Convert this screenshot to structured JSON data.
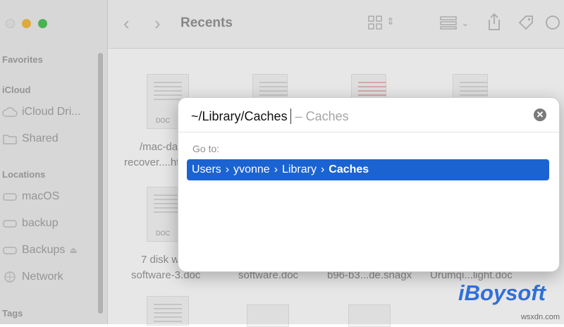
{
  "window": {
    "title": "Recents"
  },
  "sidebar": {
    "sections": [
      {
        "heading": "Favorites"
      },
      {
        "heading": "iCloud",
        "items": [
          {
            "label": "iCloud Dri...",
            "icon": "cloud-icon"
          },
          {
            "label": "Shared",
            "icon": "shared-folder-icon"
          }
        ]
      },
      {
        "heading": "Locations",
        "items": [
          {
            "label": "macOS",
            "icon": "drive-icon"
          },
          {
            "label": "backup",
            "icon": "drive-icon"
          },
          {
            "label": "Backups",
            "icon": "drive-icon",
            "badge": "eject-icon"
          },
          {
            "label": "Network",
            "icon": "network-icon"
          }
        ]
      },
      {
        "heading": "Tags"
      }
    ]
  },
  "files": {
    "row1": [
      {
        "name_line1": "/mac-da",
        "name_line2": "recover....ht",
        "type": "DOC"
      }
    ],
    "row2": [
      {
        "name_line1": "7 disk w",
        "name_line2": "software-3.doc",
        "type": "DOC"
      },
      {
        "name_line1": "",
        "name_line2": "software.doc"
      },
      {
        "name_line1": "",
        "name_line2": "b96-b3...de.snagx"
      },
      {
        "name_line1": "",
        "name_line2": "Urumqi...light.doc"
      }
    ]
  },
  "goto_dialog": {
    "path_value": "~/Library/Caches",
    "completion_hint": "– Caches",
    "label": "Go to:",
    "result_segments": [
      "Users",
      "yvonne",
      "Library",
      "Caches"
    ],
    "separator": "›"
  },
  "watermark": {
    "brand": "iBoysoft",
    "site": "wsxdn.com"
  },
  "colors": {
    "selection": "#1b63d1",
    "brand": "#2f6fd8"
  }
}
